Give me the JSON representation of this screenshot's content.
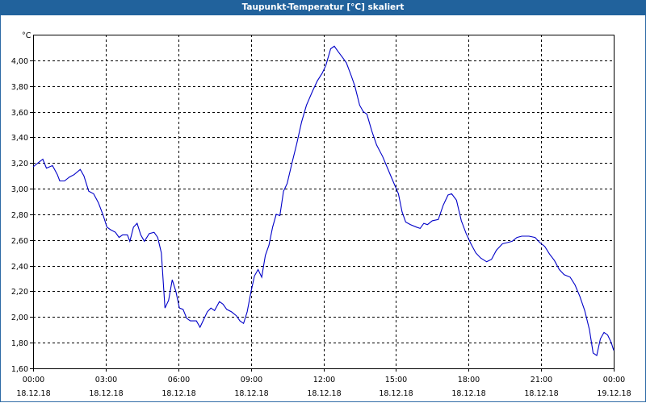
{
  "window": {
    "title": "Taupunkt-Temperatur [°C] skaliert"
  },
  "colors": {
    "title_bar": "#21629c",
    "line": "#0000c8",
    "grid": "#000000"
  },
  "chart_data": {
    "type": "line",
    "title": "Taupunkt-Temperatur [°C] skaliert",
    "ylabel": "°C",
    "xlabel": "",
    "ylim": [
      1.6,
      4.2
    ],
    "xlim": [
      0,
      24
    ],
    "grid": true,
    "y_ticks": [
      {
        "value": 1.6,
        "label": "1,60"
      },
      {
        "value": 1.8,
        "label": "1,80"
      },
      {
        "value": 2.0,
        "label": "2,00"
      },
      {
        "value": 2.2,
        "label": "2,20"
      },
      {
        "value": 2.4,
        "label": "2,40"
      },
      {
        "value": 2.6,
        "label": "2,60"
      },
      {
        "value": 2.8,
        "label": "2,80"
      },
      {
        "value": 3.0,
        "label": "3,00"
      },
      {
        "value": 3.2,
        "label": "3,20"
      },
      {
        "value": 3.4,
        "label": "3,40"
      },
      {
        "value": 3.6,
        "label": "3,60"
      },
      {
        "value": 3.8,
        "label": "3,80"
      },
      {
        "value": 4.0,
        "label": "4,00"
      }
    ],
    "x_ticks": [
      {
        "value": 0,
        "time": "00:00",
        "date": "18.12.18"
      },
      {
        "value": 3,
        "time": "03:00",
        "date": "18.12.18"
      },
      {
        "value": 6,
        "time": "06:00",
        "date": "18.12.18"
      },
      {
        "value": 9,
        "time": "09:00",
        "date": "18.12.18"
      },
      {
        "value": 12,
        "time": "12:00",
        "date": "18.12.18"
      },
      {
        "value": 15,
        "time": "15:00",
        "date": "18.12.18"
      },
      {
        "value": 18,
        "time": "18:00",
        "date": "18.12.18"
      },
      {
        "value": 21,
        "time": "21:00",
        "date": "18.12.18"
      },
      {
        "value": 24,
        "time": "00:00",
        "date": "19.12.18"
      }
    ],
    "series": [
      {
        "points": [
          [
            0.0,
            3.17
          ],
          [
            0.2,
            3.2
          ],
          [
            0.4,
            3.23
          ],
          [
            0.55,
            3.16
          ],
          [
            0.8,
            3.18
          ],
          [
            1.0,
            3.11
          ],
          [
            1.1,
            3.06
          ],
          [
            1.3,
            3.06
          ],
          [
            1.5,
            3.09
          ],
          [
            1.7,
            3.11
          ],
          [
            1.95,
            3.15
          ],
          [
            2.1,
            3.1
          ],
          [
            2.3,
            2.98
          ],
          [
            2.5,
            2.96
          ],
          [
            2.7,
            2.89
          ],
          [
            2.9,
            2.79
          ],
          [
            3.05,
            2.7
          ],
          [
            3.2,
            2.68
          ],
          [
            3.4,
            2.66
          ],
          [
            3.55,
            2.62
          ],
          [
            3.7,
            2.64
          ],
          [
            3.9,
            2.64
          ],
          [
            4.0,
            2.59
          ],
          [
            4.15,
            2.7
          ],
          [
            4.3,
            2.73
          ],
          [
            4.45,
            2.64
          ],
          [
            4.6,
            2.59
          ],
          [
            4.8,
            2.65
          ],
          [
            5.0,
            2.66
          ],
          [
            5.15,
            2.62
          ],
          [
            5.3,
            2.5
          ],
          [
            5.45,
            2.07
          ],
          [
            5.6,
            2.13
          ],
          [
            5.75,
            2.29
          ],
          [
            5.9,
            2.2
          ],
          [
            6.05,
            2.07
          ],
          [
            6.2,
            2.06
          ],
          [
            6.35,
            1.99
          ],
          [
            6.5,
            1.97
          ],
          [
            6.75,
            1.97
          ],
          [
            6.9,
            1.92
          ],
          [
            7.05,
            1.98
          ],
          [
            7.2,
            2.04
          ],
          [
            7.35,
            2.07
          ],
          [
            7.5,
            2.05
          ],
          [
            7.7,
            2.12
          ],
          [
            7.85,
            2.1
          ],
          [
            8.0,
            2.06
          ],
          [
            8.2,
            2.04
          ],
          [
            8.4,
            2.01
          ],
          [
            8.55,
            1.97
          ],
          [
            8.7,
            1.95
          ],
          [
            8.85,
            2.04
          ],
          [
            9.0,
            2.19
          ],
          [
            9.15,
            2.32
          ],
          [
            9.3,
            2.37
          ],
          [
            9.45,
            2.31
          ],
          [
            9.6,
            2.48
          ],
          [
            9.75,
            2.56
          ],
          [
            9.9,
            2.7
          ],
          [
            10.05,
            2.8
          ],
          [
            10.2,
            2.79
          ],
          [
            10.35,
            2.98
          ],
          [
            10.5,
            3.04
          ],
          [
            10.7,
            3.2
          ],
          [
            10.9,
            3.35
          ],
          [
            11.1,
            3.52
          ],
          [
            11.3,
            3.65
          ],
          [
            11.55,
            3.76
          ],
          [
            11.75,
            3.84
          ],
          [
            11.95,
            3.9
          ],
          [
            12.1,
            3.96
          ],
          [
            12.3,
            4.09
          ],
          [
            12.45,
            4.11
          ],
          [
            12.6,
            4.07
          ],
          [
            12.8,
            4.02
          ],
          [
            12.95,
            3.98
          ],
          [
            13.15,
            3.88
          ],
          [
            13.3,
            3.8
          ],
          [
            13.5,
            3.65
          ],
          [
            13.65,
            3.6
          ],
          [
            13.8,
            3.58
          ],
          [
            14.0,
            3.45
          ],
          [
            14.2,
            3.34
          ],
          [
            14.45,
            3.25
          ],
          [
            14.65,
            3.16
          ],
          [
            14.85,
            3.07
          ],
          [
            15.1,
            2.96
          ],
          [
            15.25,
            2.82
          ],
          [
            15.4,
            2.74
          ],
          [
            15.6,
            2.72
          ],
          [
            15.85,
            2.7
          ],
          [
            16.0,
            2.69
          ],
          [
            16.15,
            2.73
          ],
          [
            16.3,
            2.72
          ],
          [
            16.5,
            2.75
          ],
          [
            16.75,
            2.76
          ],
          [
            16.95,
            2.87
          ],
          [
            17.15,
            2.95
          ],
          [
            17.3,
            2.96
          ],
          [
            17.5,
            2.91
          ],
          [
            17.7,
            2.75
          ],
          [
            17.9,
            2.65
          ],
          [
            18.1,
            2.57
          ],
          [
            18.3,
            2.5
          ],
          [
            18.5,
            2.46
          ],
          [
            18.75,
            2.43
          ],
          [
            18.95,
            2.45
          ],
          [
            19.15,
            2.52
          ],
          [
            19.4,
            2.57
          ],
          [
            19.6,
            2.58
          ],
          [
            19.8,
            2.59
          ],
          [
            20.0,
            2.62
          ],
          [
            20.2,
            2.63
          ],
          [
            20.5,
            2.63
          ],
          [
            20.75,
            2.62
          ],
          [
            20.95,
            2.58
          ],
          [
            21.15,
            2.55
          ],
          [
            21.35,
            2.49
          ],
          [
            21.55,
            2.44
          ],
          [
            21.75,
            2.37
          ],
          [
            21.95,
            2.33
          ],
          [
            22.2,
            2.31
          ],
          [
            22.4,
            2.25
          ],
          [
            22.6,
            2.16
          ],
          [
            22.8,
            2.05
          ],
          [
            23.0,
            1.9
          ],
          [
            23.15,
            1.72
          ],
          [
            23.3,
            1.7
          ],
          [
            23.45,
            1.83
          ],
          [
            23.6,
            1.88
          ],
          [
            23.75,
            1.86
          ],
          [
            23.9,
            1.8
          ],
          [
            24.0,
            1.74
          ]
        ]
      }
    ]
  }
}
